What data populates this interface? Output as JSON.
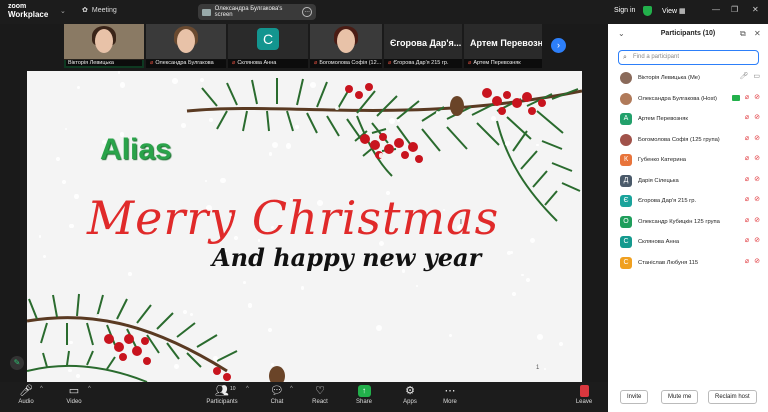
{
  "app": {
    "brand_line1": "zoom",
    "brand_line2": "Workplace",
    "meeting_label": "Meeting"
  },
  "share_pill": {
    "label": "Олександра Булгакова's screen"
  },
  "topright": {
    "signin": "Sign in",
    "view": "View"
  },
  "filmstrip": [
    {
      "name": "Вікторія Левицька",
      "type": "video",
      "active": true
    },
    {
      "name": "Олександра Булгакова",
      "type": "video",
      "active": false
    },
    {
      "name": "Склянова Анна",
      "type": "avatar",
      "initial": "С",
      "active": false
    },
    {
      "name": "Богомолова Софія (12...",
      "type": "video",
      "active": false
    },
    {
      "name": "Єгорова Дар'я 215 гр.",
      "type": "name",
      "big": "Єгорова Дар'я...",
      "active": false
    },
    {
      "name": "Артем Перевозняк",
      "type": "name",
      "big": "Артем Перевозн...",
      "active": false
    }
  ],
  "slide": {
    "title": "Alias",
    "line1": "Merry Christmas",
    "line2": "And happy new year",
    "page": "1"
  },
  "toolbar": {
    "audio": "Audio",
    "video": "Video",
    "participants": "Participants",
    "participants_count": "10",
    "chat": "Chat",
    "react": "React",
    "share": "Share",
    "apps": "Apps",
    "more": "More",
    "leave": "Leave"
  },
  "panel": {
    "title": "Participants (10)",
    "search_placeholder": "Find a participant",
    "participants": [
      {
        "name": "Вікторія Левицька (Me)",
        "initial": "",
        "color": "#8a6a5a",
        "photo": true,
        "mic": "on",
        "cam": "none"
      },
      {
        "name": "Олександра Булгакова (Host)",
        "initial": "",
        "color": "#b07a5a",
        "photo": true,
        "mic": "host",
        "cam": "off"
      },
      {
        "name": "Артем Перевозняк",
        "initial": "А",
        "color": "#22a06b",
        "mic": "muted",
        "cam": "off"
      },
      {
        "name": "Богомолова Софія (125 група)",
        "initial": "",
        "color": "#a0524a",
        "photo": true,
        "mic": "muted",
        "cam": "off"
      },
      {
        "name": "Губенко Катерина",
        "initial": "К",
        "color": "#e8743b",
        "mic": "muted",
        "cam": "off"
      },
      {
        "name": "Дарія Сілецька",
        "initial": "Д",
        "color": "#4a5a6a",
        "mic": "muted",
        "cam": "off"
      },
      {
        "name": "Єгорова Дар'я 215 гр.",
        "initial": "Є",
        "color": "#1aa39b",
        "mic": "muted",
        "cam": "off"
      },
      {
        "name": "Олександр Кубицкін 125 група",
        "initial": "О",
        "color": "#1f9e5c",
        "mic": "muted",
        "cam": "off"
      },
      {
        "name": "Склянова Анна",
        "initial": "С",
        "color": "#159a8e",
        "mic": "muted",
        "cam": "off"
      },
      {
        "name": "Станіслав Любуня 115",
        "initial": "С",
        "color": "#f0a020",
        "mic": "muted",
        "cam": "off"
      }
    ],
    "invite": "Invite",
    "mute_me": "Mute me",
    "reclaim": "Reclaim host"
  }
}
